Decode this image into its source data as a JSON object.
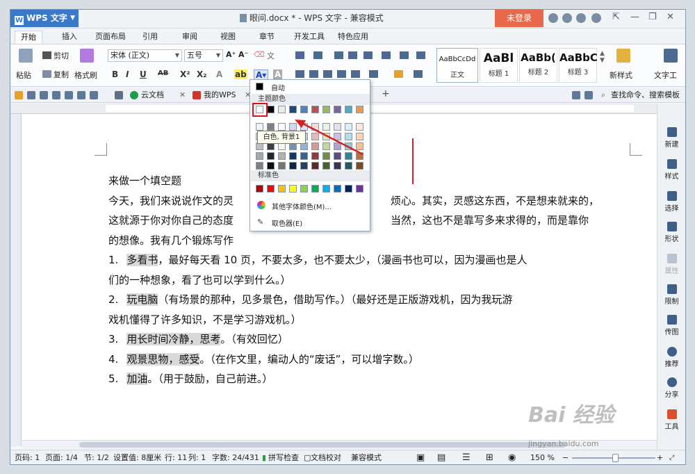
{
  "app": {
    "menu_label": "WPS 文字",
    "document_title": "眼间.docx * - WPS 文字 - 兼容模式",
    "login_button": "未登录"
  },
  "tabs": [
    "开始",
    "插入",
    "页面布局",
    "引用",
    "审阅",
    "视图",
    "章节",
    "开发工具",
    "特色应用"
  ],
  "ribbon": {
    "paste": "粘贴",
    "cut": "剪切",
    "copy": "复制",
    "format_painter": "格式刷",
    "font_name": "宋体 (正文)",
    "font_size": "五号",
    "styles": [
      {
        "preview": "AaBbCcDd",
        "label": "正文"
      },
      {
        "preview": "AaBl",
        "label": "标题 1"
      },
      {
        "preview": "AaBb(",
        "label": "标题 2"
      },
      {
        "preview": "AaBbC",
        "label": "标题 3"
      }
    ],
    "new_style": "新样式",
    "text_tools": "文字工"
  },
  "quick_access": {
    "tabs": [
      "云文档",
      "我的WPS"
    ],
    "search_placeholder": "查找命令、搜索模板"
  },
  "color_panel": {
    "auto_label": "自动",
    "theme_title": "主题颜色",
    "standard_title": "标准色",
    "more_colors": "其他字体颜色(M)...",
    "eyedropper": "取色器(E)",
    "tooltip": "白色, 背景1",
    "theme_top_row": [
      "#ffffff",
      "#000000",
      "#eeece1",
      "#1f497d",
      "#4f81bd",
      "#c0504d",
      "#9bbb59",
      "#8064a2",
      "#4bacc6",
      "#f79646"
    ],
    "standard_row": [
      "#c00000",
      "#ff0000",
      "#ffc000",
      "#ffff00",
      "#92d050",
      "#00b050",
      "#00b0f0",
      "#0070c0",
      "#002060",
      "#7030a0"
    ]
  },
  "document": {
    "lines": [
      {
        "text": "来做一个填空题",
        "hl": ""
      },
      {
        "text": "今天，我们来说说作文的灵",
        "tail": "烦心。其实，灵感这东西，不是想来就来的，",
        "hl": ""
      },
      {
        "text": "这就源于你对你自己的态度",
        "tail": "当然，这也不是靠写多来求得的，而是靠你",
        "hl": ""
      },
      {
        "text": "的想像。我有几个锻炼写作",
        "tail": "",
        "hl": ""
      },
      {
        "num": "1.",
        "hl": "多看书",
        "text": "，最好每天看 10 页，不要太多，也不要太少，（漫画书也可以，因为漫画也是人"
      },
      {
        "text": "们的一种想象，看了也可以学到什么。）",
        "hl": ""
      },
      {
        "num": "2.",
        "hl": "玩电脑",
        "text": "（有场景的那种，见多景色，借助写作。）（最好还是正版游戏机，因为我玩游"
      },
      {
        "text": "戏机懂得了许多知识，不是学习游戏机。）",
        "hl": ""
      },
      {
        "num": "3.",
        "hl": "用长时间冷静，思考",
        "text": "。（有效回忆）"
      },
      {
        "num": "4.",
        "hl": "观景思物，感受",
        "text": "。（在作文里，编动人的“废话”，可以增字数。）"
      },
      {
        "num": "5.",
        "hl": "加油",
        "text": "。（用于鼓励，自己前进。）"
      }
    ]
  },
  "sidebar": [
    "新建",
    "样式",
    "选择",
    "形状",
    "属性",
    "限制",
    "传图",
    "推荐",
    "分享",
    "工具"
  ],
  "status": {
    "page_code": "页码: 1",
    "page": "页面: 1/4",
    "section": "节: 1/2",
    "position": "设置值: 8厘米",
    "row": "行: 11",
    "col": "列: 1",
    "word_count": "字数: 24/431",
    "spell_check": "拼写检查",
    "doc_check": "文档校对",
    "mode": "兼容模式",
    "zoom": "150 %"
  },
  "watermark": {
    "brand": "Bai 经验",
    "url": "jingyan.baidu.com"
  }
}
